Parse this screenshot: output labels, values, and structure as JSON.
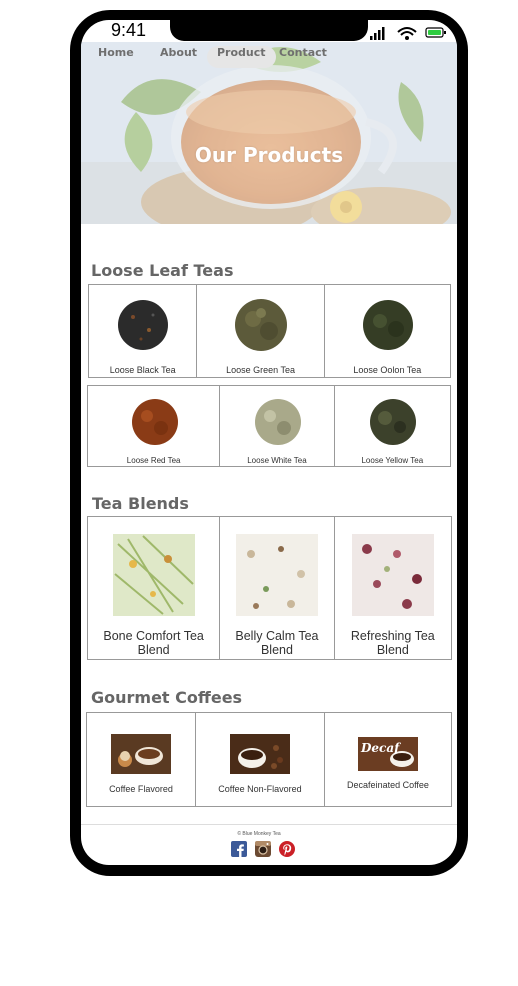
{
  "status_bar": {
    "time": "9:41"
  },
  "nav": {
    "items": [
      "Home",
      "About",
      "Product",
      "Contact"
    ],
    "active": "Product"
  },
  "hero": {
    "title": "Our Products"
  },
  "loose_leaf": {
    "title": "Loose Leaf Teas",
    "row1": [
      "Loose Black Tea",
      "Loose Green Tea",
      "Loose Oolon Tea"
    ],
    "row2": [
      "Loose Red Tea",
      "Loose White Tea",
      "Loose Yellow Tea"
    ]
  },
  "blends": {
    "title": "Tea Blends",
    "items": [
      "Bone Comfort Tea Blend",
      "Belly Calm Tea Blend",
      "Refreshing Tea Blend"
    ]
  },
  "coffees": {
    "title": "Gourmet Coffees",
    "items": [
      "Coffee Flavored",
      "Coffee Non-Flavored",
      "Decafeinated Coffee"
    ],
    "decaf_image_text": "Decaf"
  },
  "footer": {
    "copyright": "© Blue Monkey Tea"
  },
  "colors": {
    "facebook": "#3b5998",
    "pinterest": "#cb2027",
    "battery": "#2ecc40"
  }
}
